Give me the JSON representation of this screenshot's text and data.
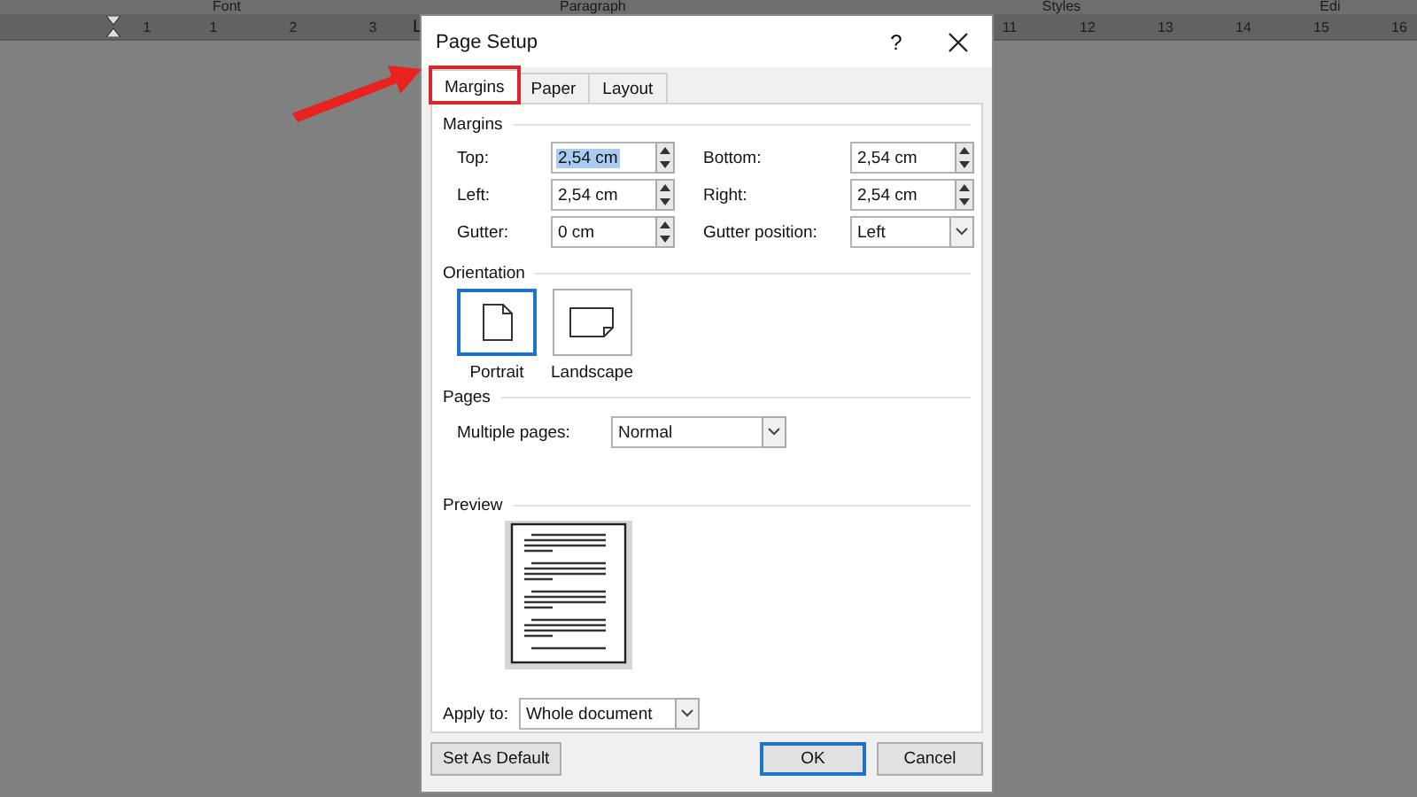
{
  "ribbon": {
    "groups": [
      "Font",
      "Paragraph",
      "Styles",
      "Edi"
    ]
  },
  "ruler": {
    "left_numbers": [
      "1",
      "1",
      "2",
      "3"
    ],
    "tab_stop": "L",
    "right_numbers": [
      "11",
      "12",
      "13",
      "14",
      "15",
      "16"
    ]
  },
  "dialog": {
    "title": "Page Setup",
    "help": "?",
    "tabs": [
      {
        "label": "Margins",
        "selected": true,
        "highlighted": true
      },
      {
        "label": "Paper",
        "selected": false,
        "highlighted": false
      },
      {
        "label": "Layout",
        "selected": false,
        "highlighted": false
      }
    ],
    "margins": {
      "heading": "Margins",
      "fields": [
        {
          "label": "Top:",
          "value": "2,54 cm",
          "kind": "spin",
          "text_selected": true
        },
        {
          "label": "Bottom:",
          "value": "2,54 cm",
          "kind": "spin",
          "text_selected": false
        },
        {
          "label": "Left:",
          "value": "2,54 cm",
          "kind": "spin",
          "text_selected": false
        },
        {
          "label": "Right:",
          "value": "2,54 cm",
          "kind": "spin",
          "text_selected": false
        },
        {
          "label": "Gutter:",
          "value": "0 cm",
          "kind": "spin",
          "text_selected": false
        },
        {
          "label": "Gutter position:",
          "value": "Left",
          "kind": "dropdown",
          "text_selected": false
        }
      ]
    },
    "orientation": {
      "heading": "Orientation",
      "options": [
        {
          "label": "Portrait",
          "kind": "portrait",
          "selected": true
        },
        {
          "label": "Landscape",
          "kind": "landscape",
          "selected": false
        }
      ]
    },
    "pages": {
      "heading": "Pages",
      "label": "Multiple pages:",
      "value": "Normal"
    },
    "preview": {
      "heading": "Preview",
      "apply_label": "Apply to:",
      "apply_value": "Whole document"
    },
    "buttons": [
      {
        "label": "Set As Default",
        "kind": "secondary",
        "default": false
      },
      {
        "label": "OK",
        "kind": "primary",
        "default": true
      },
      {
        "label": "Cancel",
        "kind": "primary",
        "default": false
      }
    ]
  }
}
